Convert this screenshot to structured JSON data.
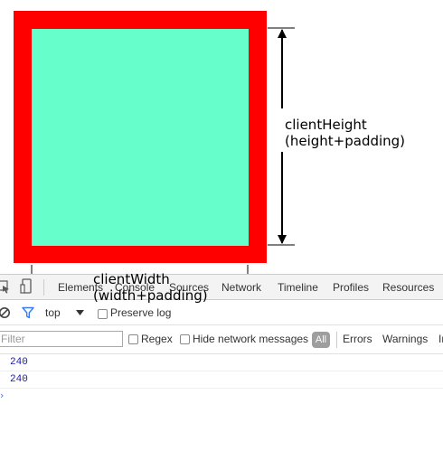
{
  "colors": {
    "border_red": "#ff0000",
    "content_aqua": "#66ffcc",
    "devtools_toolbar": "#f3f3f3",
    "log_blue": "#1a1aa6"
  },
  "annotations": {
    "height_line1": "clientHeight",
    "height_line2": "(height+padding)",
    "width_line1": "clientWidth",
    "width_line2": "(width+padding)"
  },
  "devtools": {
    "tabs": [
      "Elements",
      "Console",
      "Sources",
      "Network",
      "Timeline",
      "Profiles",
      "Resources"
    ],
    "toolbar": {
      "context_label": "top",
      "preserve_log_label": "Preserve log"
    },
    "filterbar": {
      "filter_placeholder": "Filter",
      "regex_label": "Regex",
      "hide_network_label": "Hide network messages",
      "all_label": "All",
      "errors_label": "Errors",
      "warnings_label": "Warnings",
      "info_label": "Info"
    },
    "icons": [
      "inspect-element-icon",
      "device-mode-icon",
      "clear-console-icon",
      "filter-icon",
      "dropdown-arrow-icon",
      "console-prompt-icon"
    ]
  },
  "console_output": [
    "240",
    "240"
  ]
}
